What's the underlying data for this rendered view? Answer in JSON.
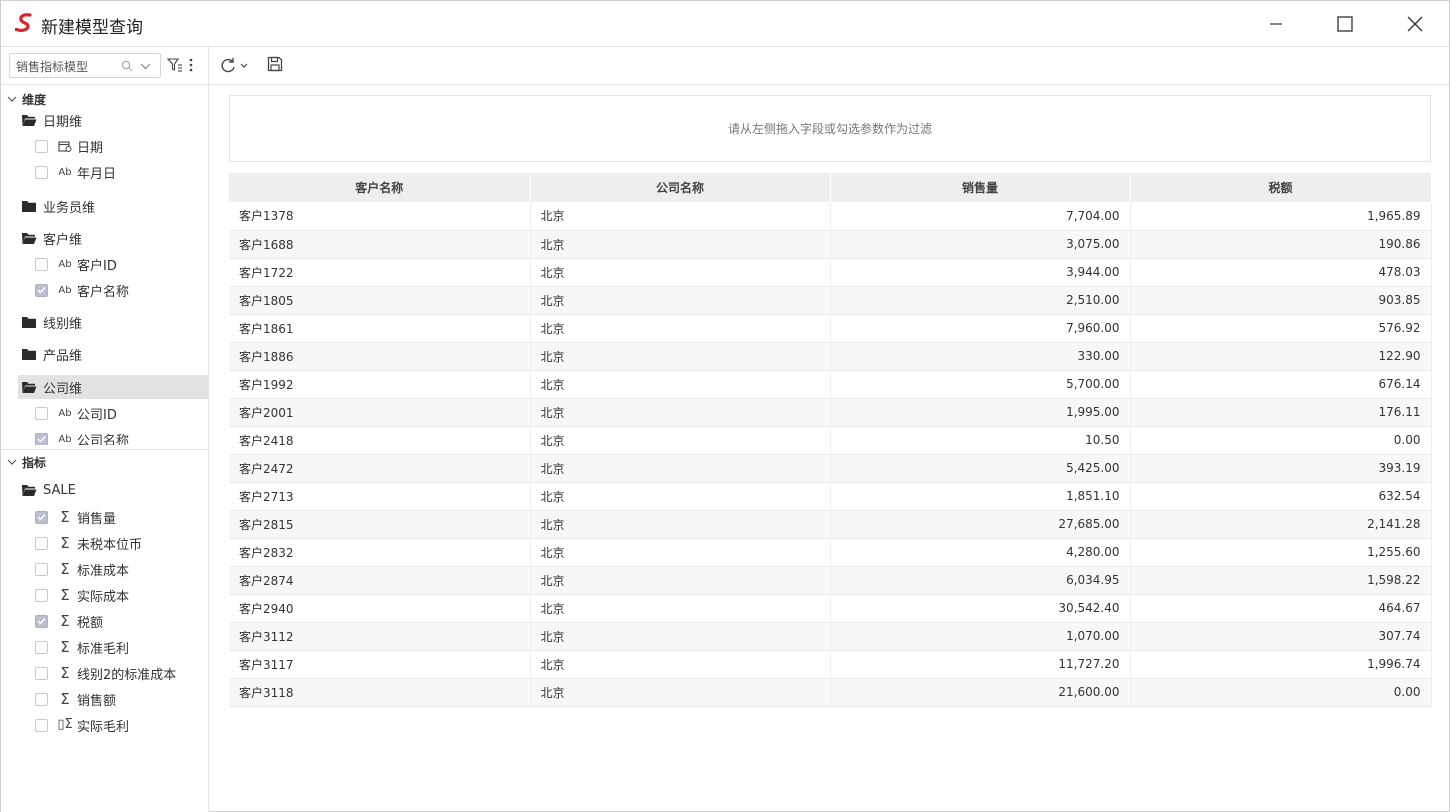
{
  "window": {
    "title": "新建模型查询",
    "accent_color": "#d9232d"
  },
  "sidebar": {
    "model_select": {
      "value": "销售指标模型",
      "icon": "search-icon"
    },
    "dimensions_label": "维度",
    "dimensions": [
      {
        "folder": "日期维",
        "expanded": true,
        "fields": [
          {
            "label": "日期",
            "type": "date",
            "checked": false
          },
          {
            "label": "年月日",
            "type": "text",
            "checked": false
          }
        ]
      },
      {
        "folder": "业务员维",
        "expanded": false,
        "fields": []
      },
      {
        "folder": "客户维",
        "expanded": true,
        "fields": [
          {
            "label": "客户ID",
            "type": "text",
            "checked": false
          },
          {
            "label": "客户名称",
            "type": "text",
            "checked": true
          }
        ]
      },
      {
        "folder": "线别维",
        "expanded": false,
        "fields": []
      },
      {
        "folder": "产品维",
        "expanded": false,
        "fields": []
      },
      {
        "folder": "公司维",
        "expanded": true,
        "selected": true,
        "fields": [
          {
            "label": "公司ID",
            "type": "text",
            "checked": false
          },
          {
            "label": "公司名称",
            "type": "text",
            "checked": true
          }
        ]
      }
    ],
    "measures_label": "指标",
    "measures_folder": "SALE",
    "measures": [
      {
        "label": "销售量",
        "checked": true,
        "type": "sum"
      },
      {
        "label": "未税本位币",
        "checked": false,
        "type": "sum"
      },
      {
        "label": "标准成本",
        "checked": false,
        "type": "sum"
      },
      {
        "label": "实际成本",
        "checked": false,
        "type": "sum"
      },
      {
        "label": "税额",
        "checked": true,
        "type": "sum"
      },
      {
        "label": "标准毛利",
        "checked": false,
        "type": "sum"
      },
      {
        "label": "线别2的标准成本",
        "checked": false,
        "type": "sum"
      },
      {
        "label": "销售额",
        "checked": false,
        "type": "sum"
      },
      {
        "label": "实际毛利",
        "checked": false,
        "type": "calc-sum"
      }
    ]
  },
  "main": {
    "filter_hint": "请从左侧拖入字段或勾选参数作为过滤",
    "columns": [
      "客户名称",
      "公司名称",
      "销售量",
      "税额"
    ],
    "rows": [
      [
        "客户1378",
        "北京",
        "7,704.00",
        "1,965.89"
      ],
      [
        "客户1688",
        "北京",
        "3,075.00",
        "190.86"
      ],
      [
        "客户1722",
        "北京",
        "3,944.00",
        "478.03"
      ],
      [
        "客户1805",
        "北京",
        "2,510.00",
        "903.85"
      ],
      [
        "客户1861",
        "北京",
        "7,960.00",
        "576.92"
      ],
      [
        "客户1886",
        "北京",
        "330.00",
        "122.90"
      ],
      [
        "客户1992",
        "北京",
        "5,700.00",
        "676.14"
      ],
      [
        "客户2001",
        "北京",
        "1,995.00",
        "176.11"
      ],
      [
        "客户2418",
        "北京",
        "10.50",
        "0.00"
      ],
      [
        "客户2472",
        "北京",
        "5,425.00",
        "393.19"
      ],
      [
        "客户2713",
        "北京",
        "1,851.10",
        "632.54"
      ],
      [
        "客户2815",
        "北京",
        "27,685.00",
        "2,141.28"
      ],
      [
        "客户2832",
        "北京",
        "4,280.00",
        "1,255.60"
      ],
      [
        "客户2874",
        "北京",
        "6,034.95",
        "1,598.22"
      ],
      [
        "客户2940",
        "北京",
        "30,542.40",
        "464.67"
      ],
      [
        "客户3112",
        "北京",
        "1,070.00",
        "307.74"
      ],
      [
        "客户3117",
        "北京",
        "11,727.20",
        "1,996.74"
      ],
      [
        "客户3118",
        "北京",
        "21,600.00",
        "0.00"
      ]
    ]
  }
}
